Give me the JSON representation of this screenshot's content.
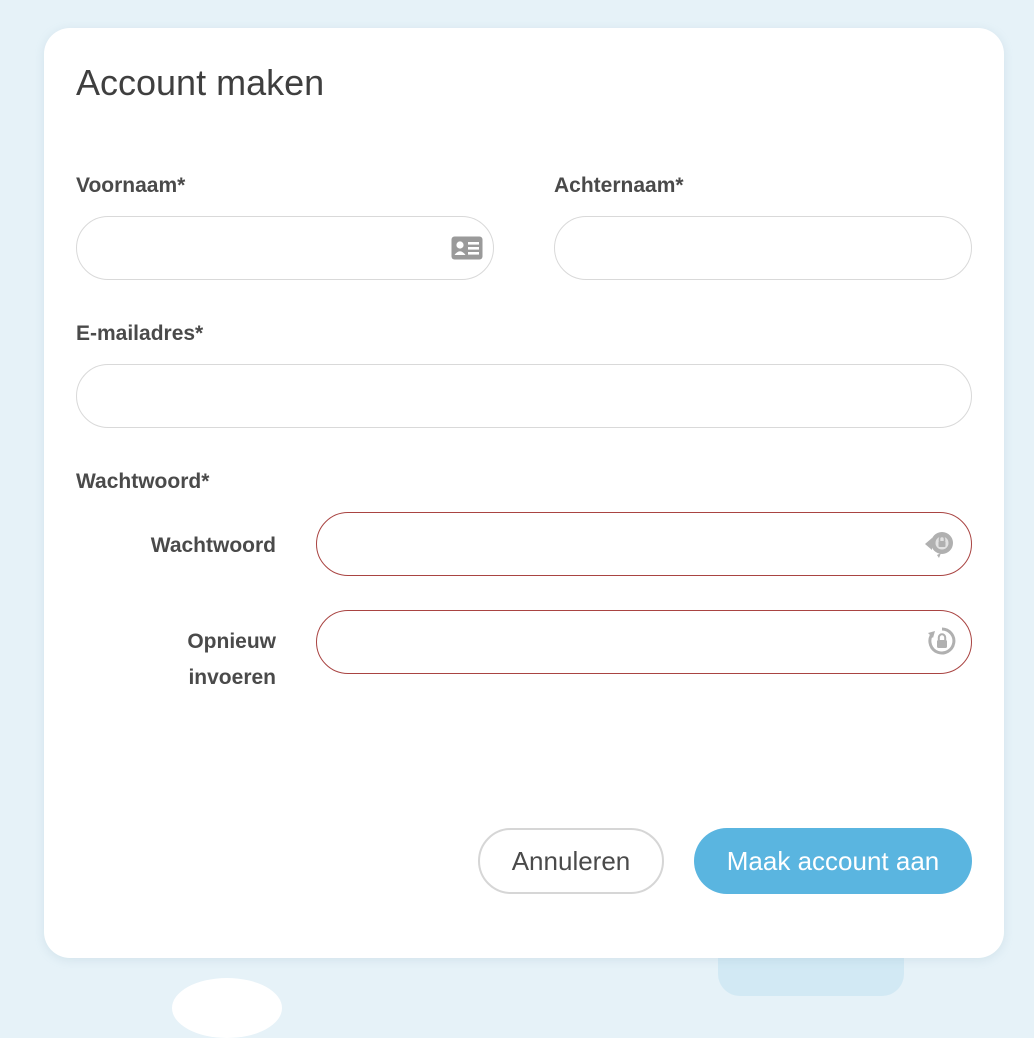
{
  "dialog": {
    "title": "Account maken"
  },
  "form": {
    "first_name": {
      "label": "Voornaam*",
      "value": "",
      "placeholder": ""
    },
    "last_name": {
      "label": "Achternaam*",
      "value": "",
      "placeholder": ""
    },
    "email": {
      "label": "E-mailadres*",
      "value": "",
      "placeholder": ""
    },
    "password_group_label": "Wachtwoord*",
    "password": {
      "label": "Wachtwoord",
      "value": "",
      "placeholder": ""
    },
    "password_repeat": {
      "label_line1": "Opnieuw",
      "label_line2": "invoeren",
      "value": "",
      "placeholder": ""
    }
  },
  "buttons": {
    "cancel_label": "Annuleren",
    "submit_label": "Maak account aan"
  },
  "icons": {
    "first_name_field": "contact-card-icon",
    "password_field": "password-manager-icon",
    "password_repeat_field": "password-lock-icon"
  },
  "colors": {
    "background": "#e6f2f8",
    "primary_button": "#5ab5e0",
    "error_border": "#a94442",
    "input_border": "#d9d9d9",
    "text": "#4a4a4a"
  }
}
